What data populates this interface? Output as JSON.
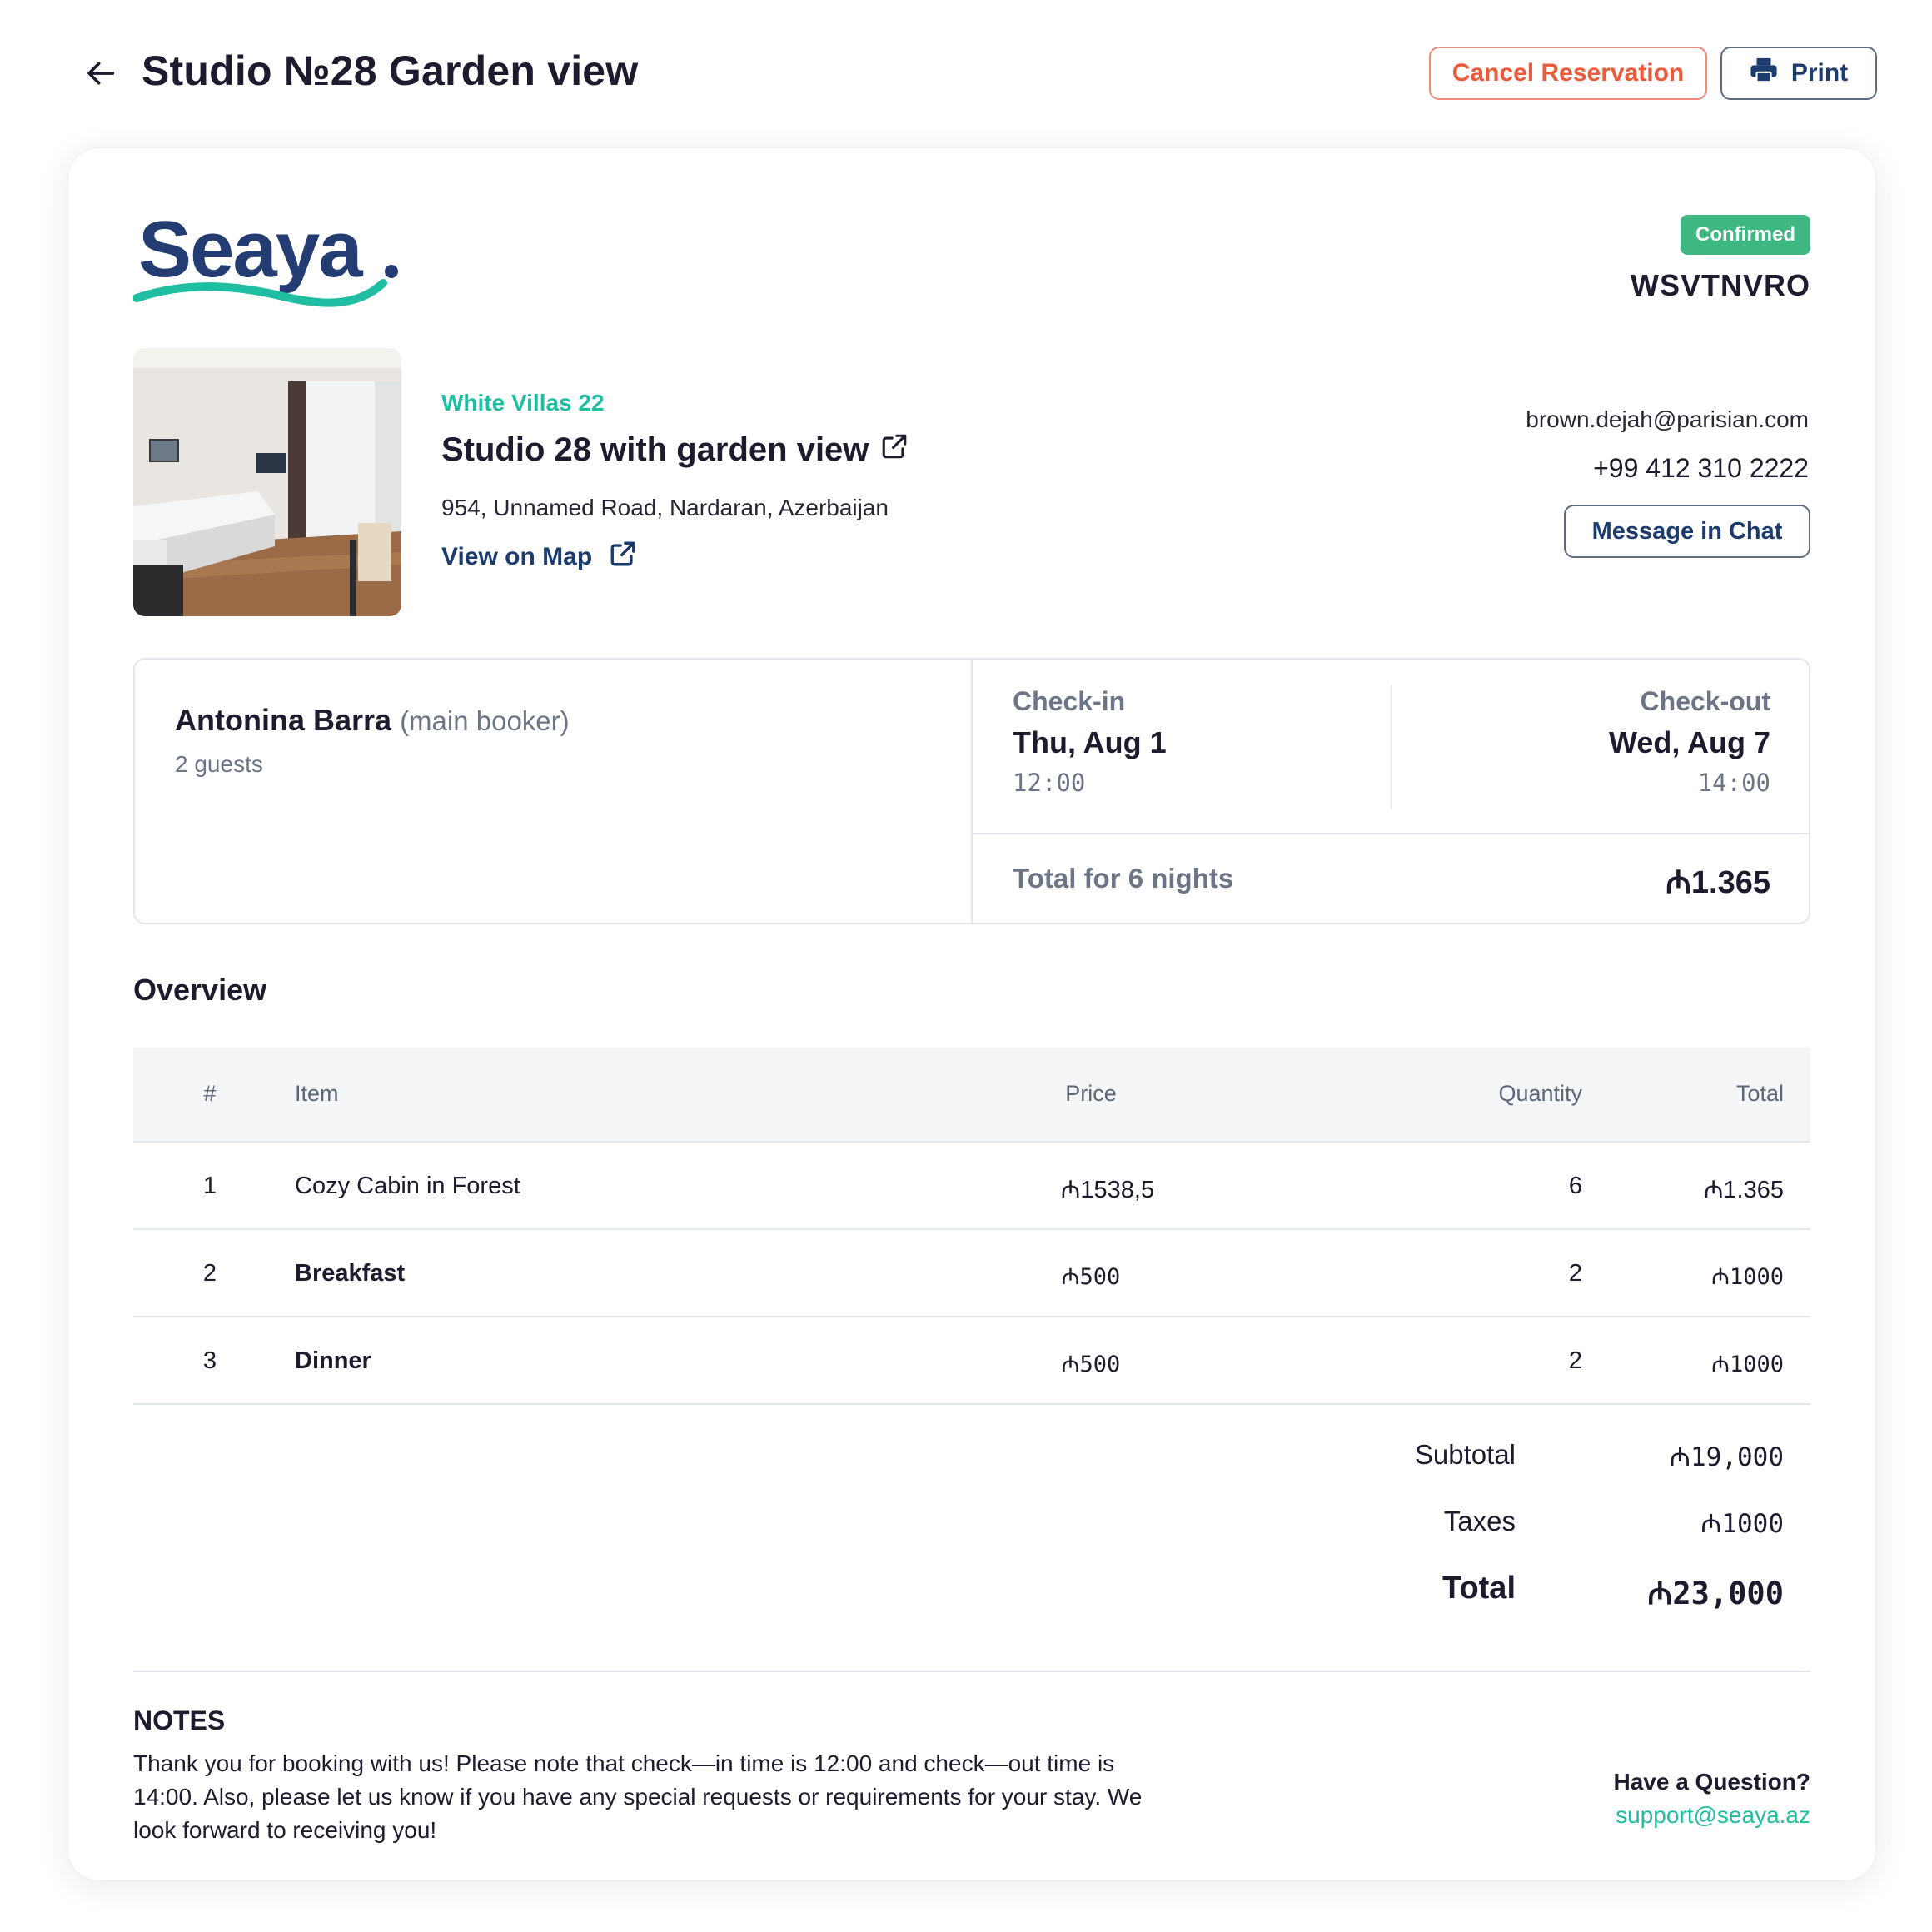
{
  "header": {
    "title": "Studio №28 Garden view",
    "cancel_label": "Cancel Reservation",
    "print_label": "Print"
  },
  "brand": {
    "logo_text": "Seaya.",
    "colors": {
      "navy": "#1d3c6e",
      "teal": "#1fbda1",
      "confirmed": "#3fb783",
      "cancel": "#ea5b3c"
    }
  },
  "reservation": {
    "status": "Confirmed",
    "code": "WSVTNVRO"
  },
  "property": {
    "name": "White Villas 22",
    "room_title": "Studio 28 with garden view",
    "address": "954, Unnamed Road, Nardaran, Azerbaijan",
    "map_label": "View on Map"
  },
  "contact": {
    "email": "brown.dejah@parisian.com",
    "phone": "+99 412 310 2222",
    "chat_label": "Message in Chat"
  },
  "booking": {
    "guest_name": "Antonina Barra",
    "guest_role": "(main booker)",
    "guests": "2 guests",
    "checkin_label": "Check-in",
    "checkin_date": "Thu, Aug 1",
    "checkin_time": "12:00",
    "checkout_label": "Check-out",
    "checkout_date": "Wed, Aug 7",
    "checkout_time": "14:00",
    "nights_label": "Total for 6 nights",
    "nights_total": "₼1.365"
  },
  "overview": {
    "title": "Overview",
    "columns": {
      "idx": "#",
      "item": "Item",
      "price": "Price",
      "qty": "Quantity",
      "total": "Total"
    },
    "rows": [
      {
        "idx": "1",
        "item": "Cozy Cabin in Forest",
        "price": "₼1538,5",
        "qty": "6",
        "total": "₼1.365"
      },
      {
        "idx": "2",
        "item": "Breakfast",
        "price": "₼500",
        "qty": "2",
        "total": "₼1000"
      },
      {
        "idx": "3",
        "item": "Dinner",
        "price": "₼500",
        "qty": "2",
        "total": "₼1000"
      }
    ],
    "subtotal_label": "Subtotal",
    "subtotal": "₼19,000",
    "taxes_label": "Taxes",
    "taxes": "₼1000",
    "total_label": "Total",
    "total": "₼23,000"
  },
  "notes": {
    "title": "NOTES",
    "text": "Thank you for booking with us! Please note that check—in time is 12:00 and check—out time is 14:00. Also, please let us know if you have any special requests or requirements for your stay. We look forward to receiving you!",
    "question": "Have a Question?",
    "support_email": "support@seaya.az"
  }
}
